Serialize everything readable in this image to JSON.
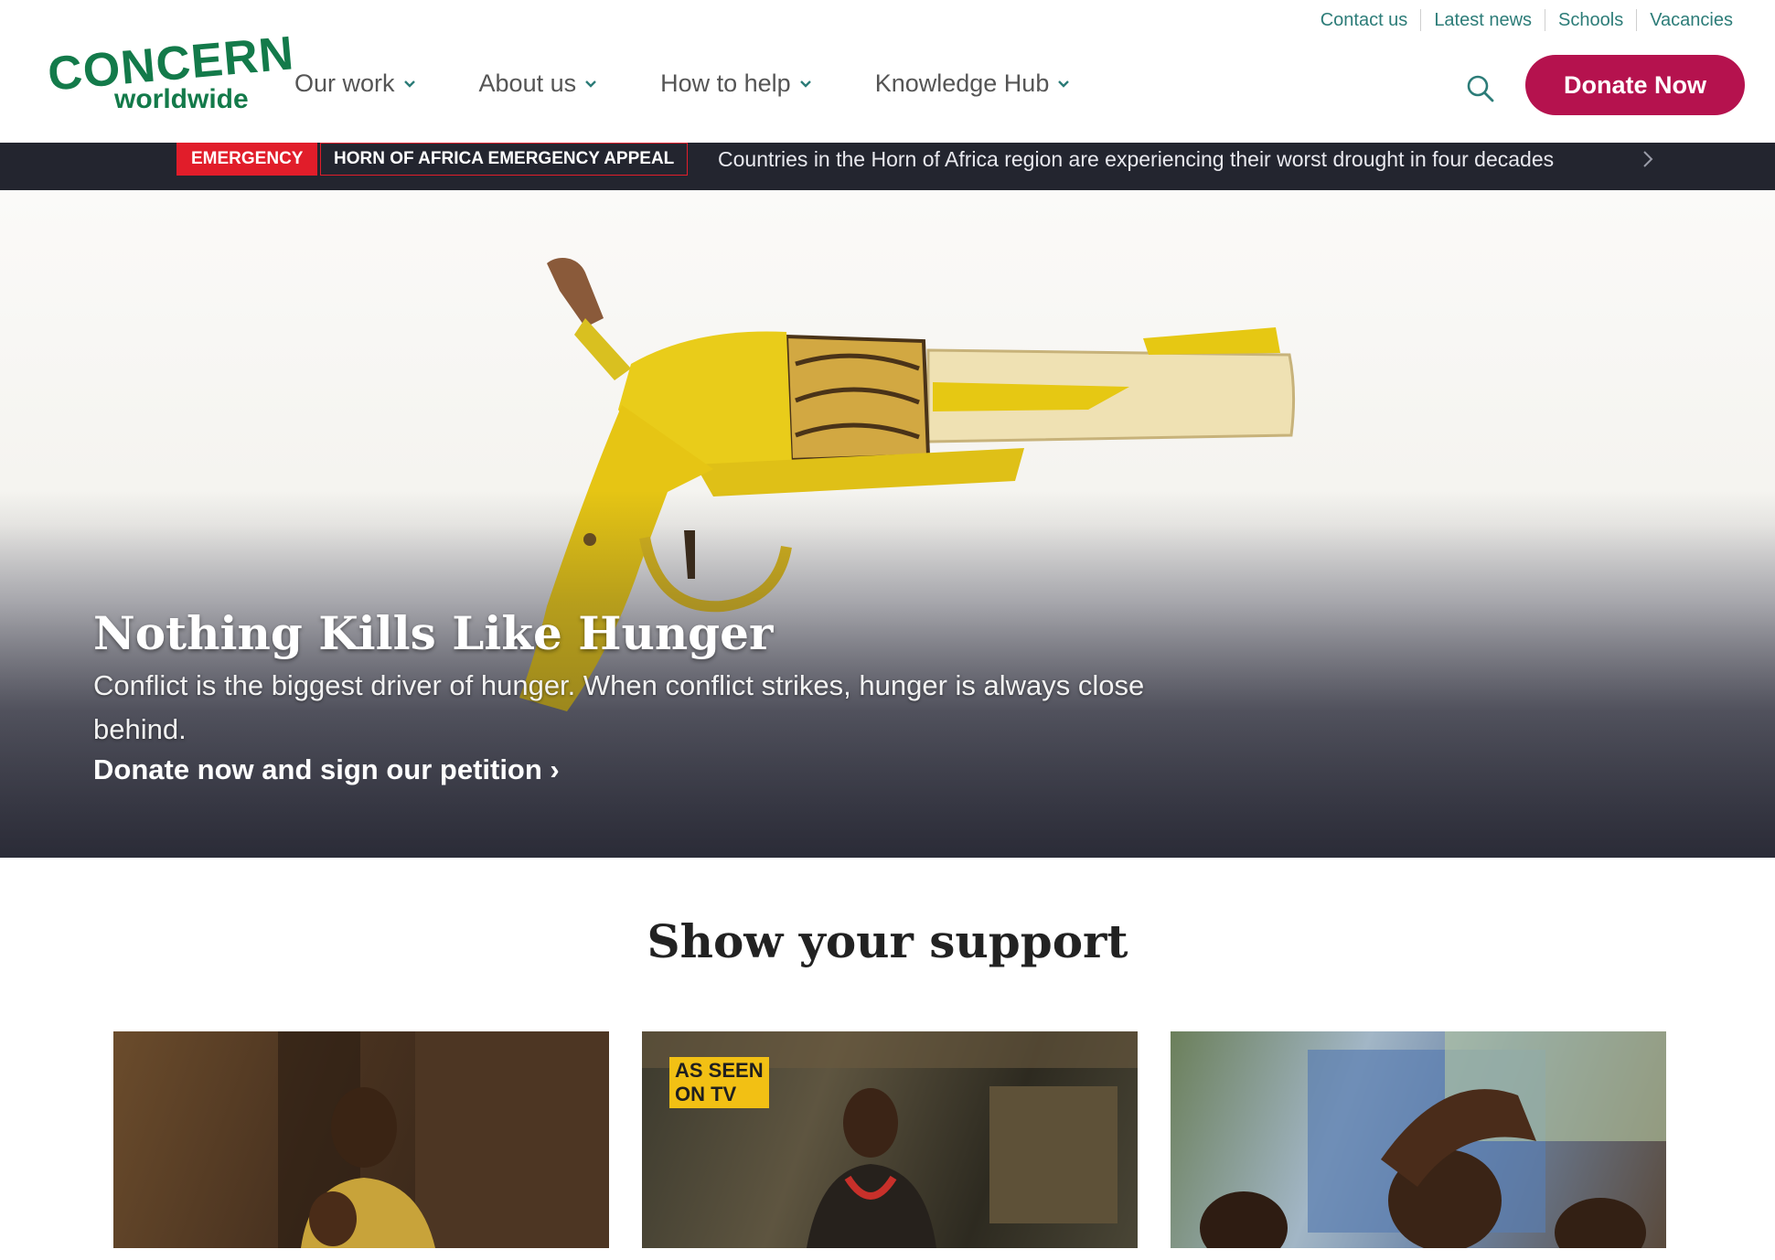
{
  "header": {
    "logo": {
      "line1": "CONCERN",
      "line2": "worldwide"
    },
    "utility_links": [
      "Contact us",
      "Latest news",
      "Schools",
      "Vacancies"
    ],
    "nav": [
      {
        "label": "Our work"
      },
      {
        "label": "About us"
      },
      {
        "label": "How to help"
      },
      {
        "label": "Knowledge Hub"
      }
    ],
    "donate_label": "Donate Now"
  },
  "banner": {
    "emergency_tag": "EMERGENCY",
    "appeal_tag": "HORN OF AFRICA EMERGENCY APPEAL",
    "text": "Countries in the Horn of Africa region are experiencing their worst drought in four decades"
  },
  "hero": {
    "title": "Nothing Kills Like Hunger",
    "subtitle": "Conflict is the biggest driver of hunger. When conflict strikes, hunger is always close behind.",
    "cta": "Donate now and sign our petition ›"
  },
  "support": {
    "heading": "Show your support",
    "cards": [
      {
        "badge": ""
      },
      {
        "badge": "AS SEEN ON TV"
      },
      {
        "badge": ""
      }
    ]
  },
  "colors": {
    "brand_green": "#137a4a",
    "donate": "#b5124e",
    "banner_bg": "#23252f",
    "emergency_red": "#e11d2a",
    "util_link": "#2c7c78"
  },
  "icons": [
    "chevron-down-icon",
    "search-icon",
    "chevron-right-icon"
  ]
}
